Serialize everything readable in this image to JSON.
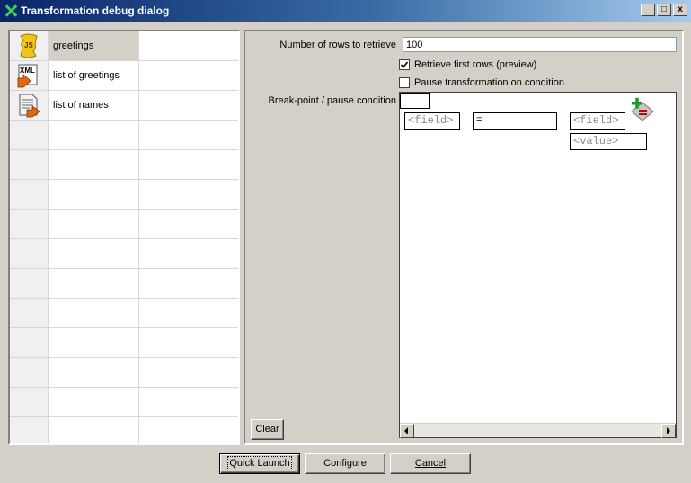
{
  "window": {
    "title": "Transformation debug dialog",
    "controls": {
      "minimize": "_",
      "maximize": "□",
      "close": "x"
    }
  },
  "steps": [
    {
      "icon": "javascript-step-icon",
      "name": "greetings",
      "selected": true
    },
    {
      "icon": "xml-step-icon",
      "name": "list of greetings",
      "selected": false
    },
    {
      "icon": "text-file-step-icon",
      "name": "list of names",
      "selected": false
    }
  ],
  "empty_rows": 11,
  "settings": {
    "rows_label": "Number of rows to retrieve",
    "rows_value": "100",
    "retrieve_first_label": "Retrieve first rows (preview)",
    "retrieve_first_checked": true,
    "pause_label": "Pause transformation on condition",
    "pause_checked": false,
    "breakpoint_label": "Break-point / pause condition"
  },
  "condition": {
    "left_field": "<field>",
    "operator": "=",
    "right_field": "<field>",
    "right_value": "<value>"
  },
  "buttons": {
    "clear": "Clear",
    "quick_launch": "Quick Launch",
    "configure": "Configure",
    "cancel": "Cancel"
  },
  "colors": {
    "dialog_bg": "#d4d0c8",
    "titlebar_start": "#0a246a",
    "titlebar_end": "#a6caf0",
    "placeholder_text": "#8a8a8a"
  }
}
